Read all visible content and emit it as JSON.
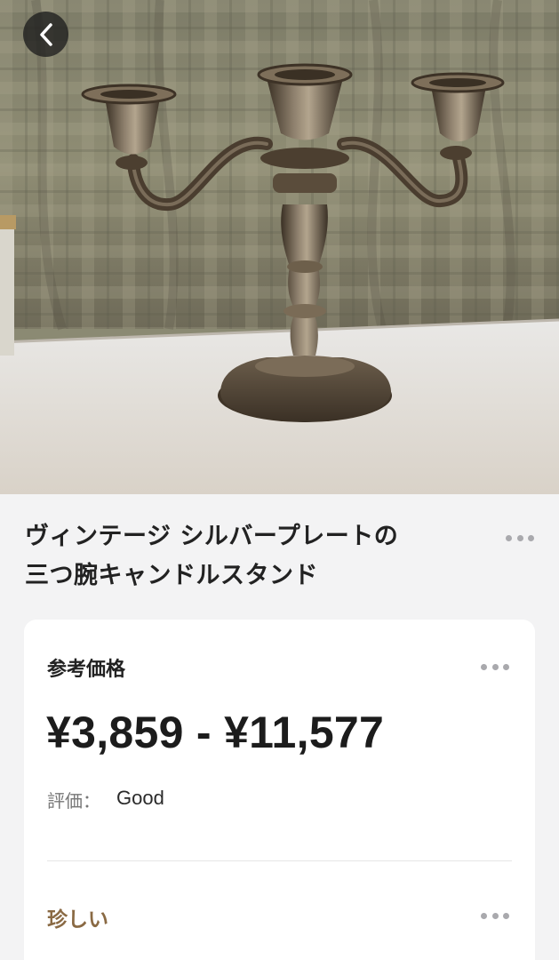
{
  "navigation": {
    "back_icon": "chevron-left-icon"
  },
  "product": {
    "title_line1": "ヴィンテージ シルバープレートの",
    "title_line2": "三つ腕キャンドルスタンド",
    "more_icon": "more-horizontal-icon"
  },
  "price_card": {
    "label": "参考価格",
    "price_range": "¥3,859 - ¥11,577",
    "rating_label": "評価：",
    "rating_value": "Good",
    "rarity_label": "珍しい"
  },
  "colors": {
    "background": "#f3f3f4",
    "card": "#ffffff",
    "rarity": "#8a6a44",
    "dots": "#a9a9ad"
  }
}
